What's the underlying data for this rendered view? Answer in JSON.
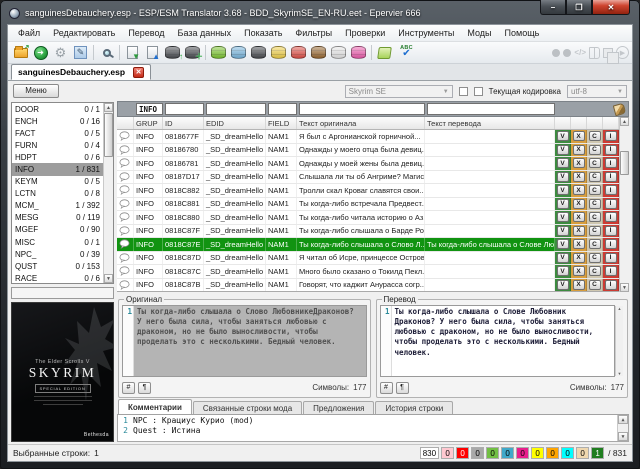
{
  "window": {
    "title": "sanguinesDebauchery.esp - ESP/ESM Translator 3.68 - BDD_SkyrimSE_EN-RU.eet - Epervier 666",
    "controls": {
      "minimize": "–",
      "maximize": "❐",
      "close": "✕"
    }
  },
  "menu": [
    "Файл",
    "Редактировать",
    "Перевод",
    "База данных",
    "Показать",
    "Фильтры",
    "Проверки",
    "Инструменты",
    "Моды",
    "Помощь"
  ],
  "toolbar": {
    "spellcheck_label": "ABC"
  },
  "tab": {
    "label": "sanguinesDebauchery.esp",
    "close": "✕"
  },
  "left_panel": {
    "menu_button": "Меню",
    "groups": [
      {
        "name": "DOOR",
        "count": "0 / 1"
      },
      {
        "name": "ENCH",
        "count": "0 / 16"
      },
      {
        "name": "FACT",
        "count": "0 / 5"
      },
      {
        "name": "FURN",
        "count": "0 / 4"
      },
      {
        "name": "HDPT",
        "count": "0 / 6"
      },
      {
        "name": "INFO",
        "count": "1 / 831",
        "selected": true
      },
      {
        "name": "KEYM",
        "count": "0 / 5"
      },
      {
        "name": "LCTN",
        "count": "0 / 8"
      },
      {
        "name": "MCM_",
        "count": "1 / 392"
      },
      {
        "name": "MESG",
        "count": "0 / 119"
      },
      {
        "name": "MGEF",
        "count": "0 / 90"
      },
      {
        "name": "MISC",
        "count": "0 / 1"
      },
      {
        "name": "NPC_",
        "count": "0 / 39"
      },
      {
        "name": "QUST",
        "count": "0 / 153"
      },
      {
        "name": "RACE",
        "count": "0 / 6"
      }
    ],
    "poster": {
      "series": "The Elder Scrolls V",
      "title": "SKYRIM",
      "edition": "SPECIAL EDITION",
      "publisher": "Bethesda"
    }
  },
  "controls": {
    "game_select": "Skyrim SE",
    "encoding_label": "Текущая кодировка",
    "encoding_select": "utf-8"
  },
  "filter_row": {
    "grup": "INFO",
    "id": "",
    "edid": "",
    "field": "",
    "original": "",
    "translation": ""
  },
  "table": {
    "columns": [
      "GRUP",
      "ID",
      "EDID",
      "FIELD",
      "Текст оригинала",
      "Текст перевода"
    ],
    "row_buttons": [
      "V",
      "X",
      "C",
      "I"
    ],
    "rows": [
      {
        "grup": "INFO",
        "id": "0818677F",
        "edid": "_SD_dreamHello",
        "field": "NAM1",
        "original": "Я был с Аргонианской горничной...",
        "translation": ""
      },
      {
        "grup": "INFO",
        "id": "08186780",
        "edid": "_SD_dreamHello",
        "field": "NAM1",
        "original": "Однажды у моего отца была девиц...",
        "translation": ""
      },
      {
        "grup": "INFO",
        "id": "08186781",
        "edid": "_SD_dreamHello",
        "field": "NAM1",
        "original": "Однажды у моей жены была девиц...",
        "translation": ""
      },
      {
        "grup": "INFO",
        "id": "08187D17",
        "edid": "_SD_dreamHello",
        "field": "NAM1",
        "original": "Слышала ли ты об Ангриме? Магис...",
        "translation": ""
      },
      {
        "grup": "INFO",
        "id": "0818C882",
        "edid": "_SD_dreamHello",
        "field": "NAM1",
        "original": "Тролли скал Кроваг славятся свои...",
        "translation": ""
      },
      {
        "grup": "INFO",
        "id": "0818C881",
        "edid": "_SD_dreamHello",
        "field": "NAM1",
        "original": "Ты когда-либо встречала Предвест...",
        "translation": ""
      },
      {
        "grup": "INFO",
        "id": "0818C880",
        "edid": "_SD_dreamHello",
        "field": "NAM1",
        "original": "Ты когда-либо читала историю о Аз...",
        "translation": ""
      },
      {
        "grup": "INFO",
        "id": "0818C87F",
        "edid": "_SD_dreamHello",
        "field": "NAM1",
        "original": "Ты когда-либо слышала о Барде Ро...",
        "translation": ""
      },
      {
        "grup": "INFO",
        "id": "0818C87E",
        "edid": "_SD_dreamHello",
        "field": "NAM1",
        "original": "Ты когда-либо слышала о Слово Л...",
        "translation": "Ты когда-либо слышала о Слове Любовник ...",
        "selected": true
      },
      {
        "grup": "INFO",
        "id": "0818C87D",
        "edid": "_SD_dreamHello",
        "field": "NAM1",
        "original": "Я читал об Исре, принцессе Остров...",
        "translation": ""
      },
      {
        "grup": "INFO",
        "id": "0818C87C",
        "edid": "_SD_dreamHello",
        "field": "NAM1",
        "original": "Много было сказано о Токилд Пекл...",
        "translation": ""
      },
      {
        "grup": "INFO",
        "id": "0818C87B",
        "edid": "_SD_dreamHello",
        "field": "NAM1",
        "original": "Говорят, что каджит Анурасса согр...",
        "translation": ""
      }
    ]
  },
  "original_panel": {
    "label": "Оригинал",
    "line_number": "1",
    "text": "Ты когда-либо слышала о Слово ЛюбовникеДраконов? У него была сила, чтобы заняться любовью с драконом, но не было выносливости, чтобы проделать это с несколькими. Бедный человек.",
    "hash_button": "#",
    "pilcrow_button": "¶",
    "chars_label": "Символы:",
    "chars_value": "177"
  },
  "translation_panel": {
    "label": "Перевод",
    "line_number": "1",
    "text": "Ты когда-либо слышала о Слове Любовник Драконов? У него была сила, чтобы заняться любовью с драконом, но не было выносливости, чтобы проделать это с несколькими. Бедный человек.",
    "hash_button": "#",
    "pilcrow_button": "¶",
    "chars_label": "Символы:",
    "chars_value": "177"
  },
  "bottom_tabs": [
    {
      "label": "Комментарии",
      "active": true
    },
    {
      "label": "Связанные строки мода"
    },
    {
      "label": "Предложения"
    },
    {
      "label": "История строки"
    }
  ],
  "comments": {
    "lines": [
      {
        "num": "1",
        "text": "NPC : Крациус Курио (mod)"
      },
      {
        "num": "2",
        "text": "Quest : Истина"
      }
    ]
  },
  "status_bar": {
    "selected_label": "Выбранные строки:",
    "selected_value": "1",
    "counters": [
      {
        "value": "830",
        "bg": "#ffffff",
        "fg": "#000000"
      },
      {
        "value": "0",
        "bg": "#ffc8d0",
        "fg": "#000000"
      },
      {
        "value": "0",
        "bg": "#ff0000",
        "fg": "#ffffff"
      },
      {
        "value": "0",
        "bg": "#a9a9a9",
        "fg": "#000000"
      },
      {
        "value": "0",
        "bg": "#72bf44",
        "fg": "#000000"
      },
      {
        "value": "0",
        "bg": "#3fa9c9",
        "fg": "#000000"
      },
      {
        "value": "0",
        "bg": "#e81e8c",
        "fg": "#000000"
      },
      {
        "value": "0",
        "bg": "#ffff00",
        "fg": "#000000"
      },
      {
        "value": "0",
        "bg": "#ffa500",
        "fg": "#000000"
      },
      {
        "value": "0",
        "bg": "#00ffff",
        "fg": "#000000"
      },
      {
        "value": "0",
        "bg": "#efd7ae",
        "fg": "#000000"
      },
      {
        "value": "1",
        "bg": "#1f7d1f",
        "fg": "#ffffff"
      }
    ],
    "total": "/  831"
  }
}
